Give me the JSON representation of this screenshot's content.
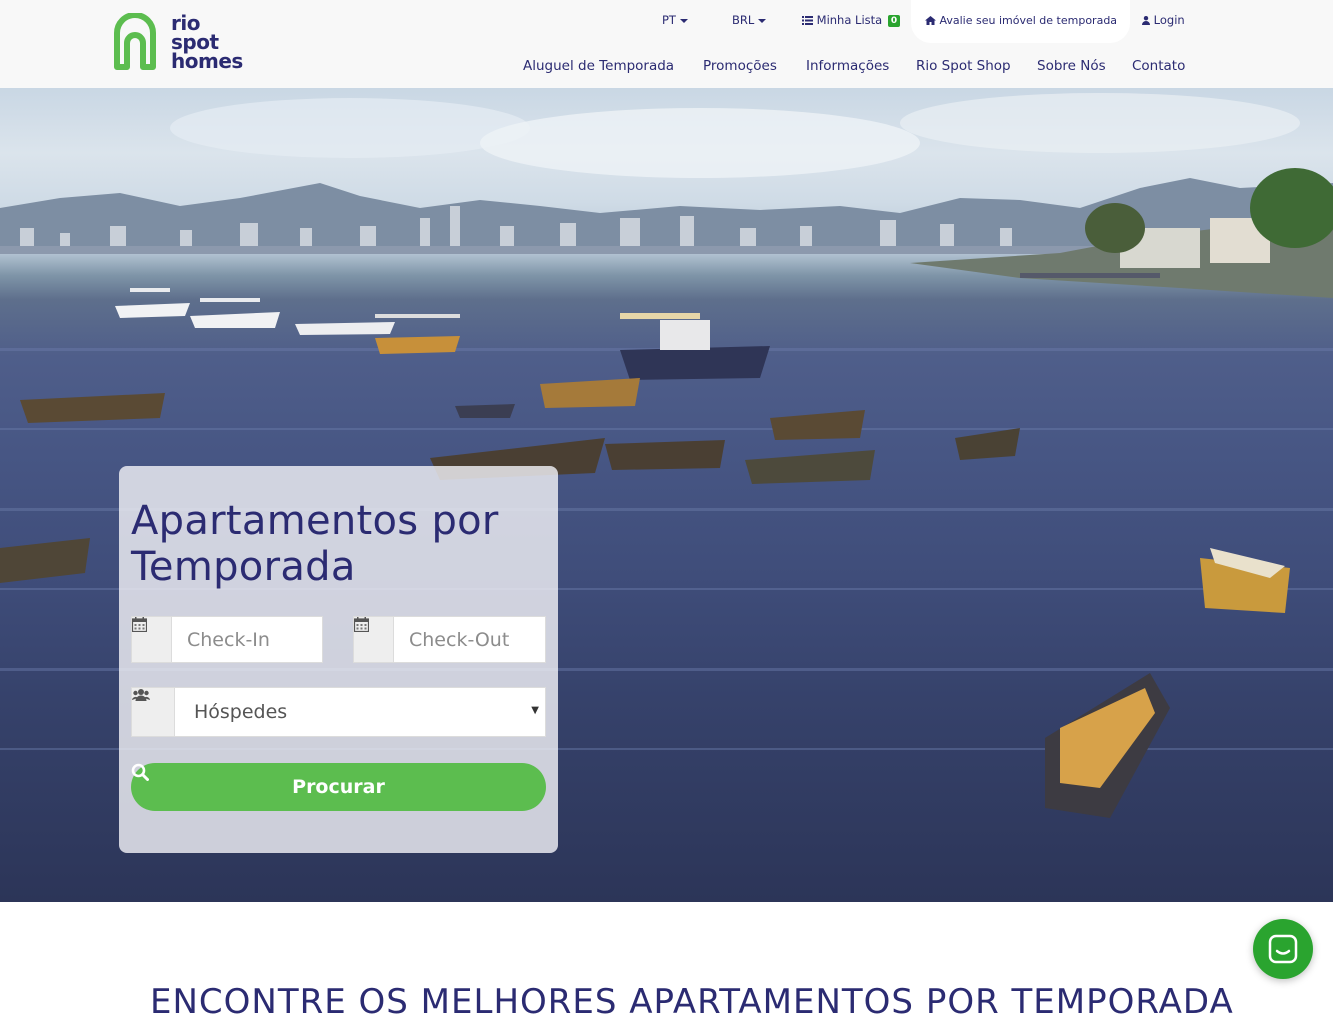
{
  "brand": {
    "logo_lines": [
      "rio",
      "spot",
      "homes"
    ],
    "logo_color": "#2b2b72",
    "accent_green": "#5cbd4f"
  },
  "topbar": {
    "language": "PT",
    "currency": "BRL",
    "wishlist_label": "Minha Lista",
    "wishlist_count": "0",
    "evaluate_label": "Avalie seu imóvel de temporada",
    "login_label": "Login"
  },
  "nav": {
    "items": [
      "Aluguel de Temporada",
      "Promoções",
      "Informações",
      "Rio Spot Shop",
      "Sobre Nós",
      "Contato"
    ]
  },
  "search": {
    "title_line1": "Apartamentos por",
    "title_line2": "Temporada",
    "checkin_placeholder": "Check-In",
    "checkout_placeholder": "Check-Out",
    "guests_label": "Hóspedes",
    "submit_label": "Procurar"
  },
  "section": {
    "title": "ENCONTRE OS MELHORES APARTAMENTOS POR TEMPORADA"
  },
  "icons": {
    "calendar": "calendar-icon",
    "users": "users-icon",
    "search": "search-icon",
    "home": "home-icon",
    "user": "user-icon",
    "list": "list-icon",
    "chat": "chat-icon"
  }
}
